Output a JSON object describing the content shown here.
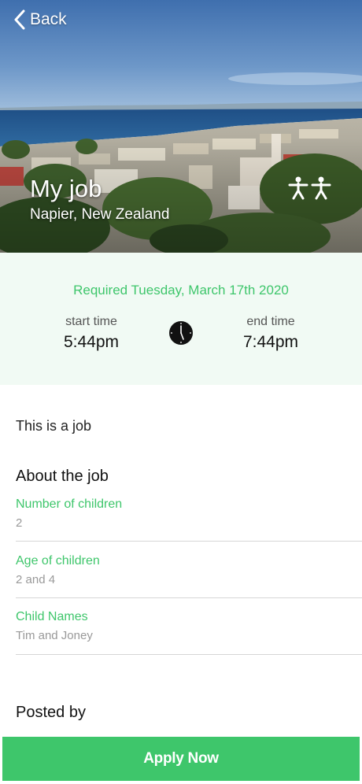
{
  "header": {
    "back_label": "Back",
    "title": "My job",
    "location": "Napier, New Zealand",
    "icons": {
      "back": "chevron-left-icon",
      "children": "two-children-icon"
    }
  },
  "schedule": {
    "required": "Required Tuesday, March 17th 2020",
    "start_label": "start time",
    "start_time": "5:44pm",
    "end_label": "end time",
    "end_time": "7:44pm",
    "icon": "clock-icon"
  },
  "description": "This is a job",
  "about": {
    "title": "About the job",
    "details": [
      {
        "label": "Number of children",
        "value": "2"
      },
      {
        "label": "Age of children",
        "value": "2 and 4"
      },
      {
        "label": "Child Names",
        "value": "Tim and Joney"
      }
    ]
  },
  "posted_by": {
    "title": "Posted by"
  },
  "apply_label": "Apply Now",
  "colors": {
    "accent": "#3ec66b",
    "panel_bg": "#f1faf4",
    "muted_text": "#999999"
  }
}
